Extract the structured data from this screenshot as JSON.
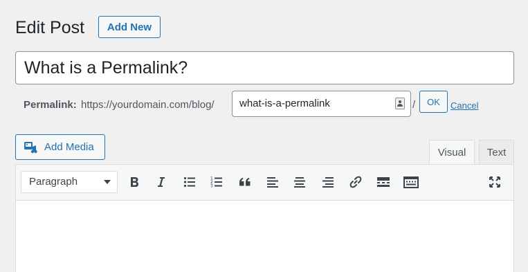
{
  "header": {
    "title": "Edit Post",
    "add_new_label": "Add New"
  },
  "post": {
    "title_value": "What is a Permalink?"
  },
  "permalink": {
    "label": "Permalink:",
    "base_url": "https://yourdomain.com/blog/",
    "slug_value": "what-is-a-permalink",
    "separator": "/",
    "ok_label": "OK",
    "cancel_label": "Cancel"
  },
  "media": {
    "add_media_label": "Add Media"
  },
  "editor": {
    "tabs": [
      {
        "label": "Visual",
        "active": true
      },
      {
        "label": "Text",
        "active": false
      }
    ],
    "format_select": "Paragraph",
    "toolbar_icons": [
      "bold-icon",
      "italic-icon",
      "bulleted-list-icon",
      "numbered-list-icon",
      "blockquote-icon",
      "align-left-icon",
      "align-center-icon",
      "align-right-icon",
      "link-icon",
      "read-more-icon",
      "toolbar-toggle-icon",
      "fullscreen-icon"
    ]
  },
  "colors": {
    "accent": "#2271b1",
    "background": "#f0f0f1",
    "text": "#1d2327"
  }
}
